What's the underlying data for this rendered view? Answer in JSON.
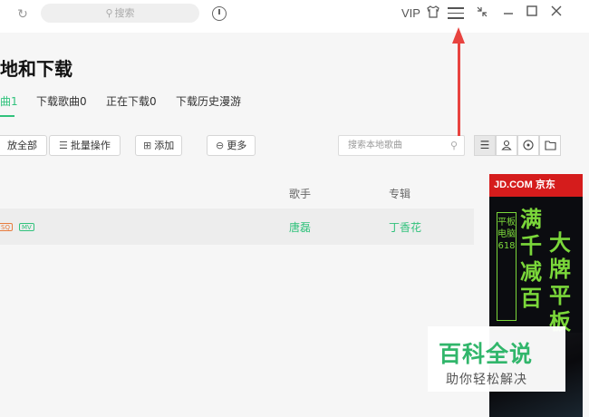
{
  "titlebar": {
    "search_placeholder": "搜索",
    "vip_label": "VIP",
    "icons": [
      "refresh-icon",
      "clock-icon",
      "skin-icon",
      "menu-icon",
      "mini-mode-icon",
      "minimize-icon",
      "maximize-icon",
      "close-icon"
    ]
  },
  "page": {
    "title": "地和下载",
    "tabs": [
      {
        "label": "曲1",
        "active": true
      },
      {
        "label": "下载歌曲0"
      },
      {
        "label": "正在下载0"
      },
      {
        "label": "下载历史漫游"
      }
    ]
  },
  "toolbar": {
    "play_all": "放全部",
    "batch": "批量操作",
    "add": "添加",
    "more": "更多",
    "local_search_placeholder": "搜索本地歌曲"
  },
  "table": {
    "columns": {
      "singer": "歌手",
      "album": "专辑"
    },
    "rows": [
      {
        "badge_sq": "SQ",
        "badge_mv": "MV",
        "singer": "唐磊",
        "album": "丁香花"
      }
    ]
  },
  "ad": {
    "brand": "JD.COM 京东",
    "vertical": "平板电脑618",
    "col1": "满千减百",
    "col2": "大牌平板"
  },
  "watermark": {
    "title": "百科全说",
    "subtitle": "助你轻松解决"
  },
  "colors": {
    "accent": "#31c27c",
    "arrow": "#e8433f",
    "ad_red": "#d51c1c",
    "ad_green": "#7bd73a"
  }
}
